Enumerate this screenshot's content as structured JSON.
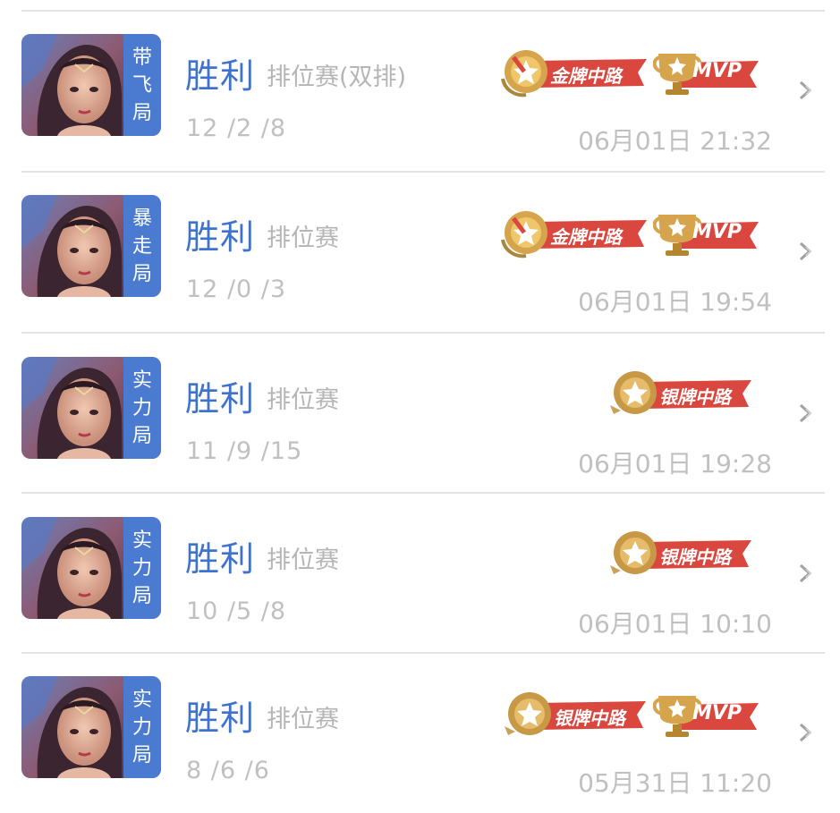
{
  "colors": {
    "result_blue": "#3f72cc",
    "tag_blue": "#4a7bd0",
    "gold_badge": "#d4a24a",
    "ribbon_red": "#d9473f",
    "muted_text": "#c0c0c0"
  },
  "matches": [
    {
      "tag": [
        "带",
        "飞",
        "局"
      ],
      "result": "胜利",
      "mode": "排位赛(双排)",
      "kda": "12 /2 /8",
      "time": "06月01日 21:32",
      "medal": {
        "kind": "gold",
        "label": "金牌中路"
      },
      "mvp": {
        "label": "MVP"
      }
    },
    {
      "tag": [
        "暴",
        "走",
        "局"
      ],
      "result": "胜利",
      "mode": "排位赛",
      "kda": "12 /0 /3",
      "time": "06月01日 19:54",
      "medal": {
        "kind": "gold",
        "label": "金牌中路"
      },
      "mvp": {
        "label": "MVP"
      }
    },
    {
      "tag": [
        "实",
        "力",
        "局"
      ],
      "result": "胜利",
      "mode": "排位赛",
      "kda": "11 /9 /15",
      "time": "06月01日 19:28",
      "medal": {
        "kind": "silver",
        "label": "银牌中路"
      },
      "mvp": null
    },
    {
      "tag": [
        "实",
        "力",
        "局"
      ],
      "result": "胜利",
      "mode": "排位赛",
      "kda": "10 /5 /8",
      "time": "06月01日 10:10",
      "medal": {
        "kind": "silver",
        "label": "银牌中路"
      },
      "mvp": null
    },
    {
      "tag": [
        "实",
        "力",
        "局"
      ],
      "result": "胜利",
      "mode": "排位赛",
      "kda": "8 /6 /6",
      "time": "05月31日 11:20",
      "medal": {
        "kind": "silver",
        "label": "银牌中路"
      },
      "mvp": {
        "label": "MVP"
      }
    }
  ]
}
